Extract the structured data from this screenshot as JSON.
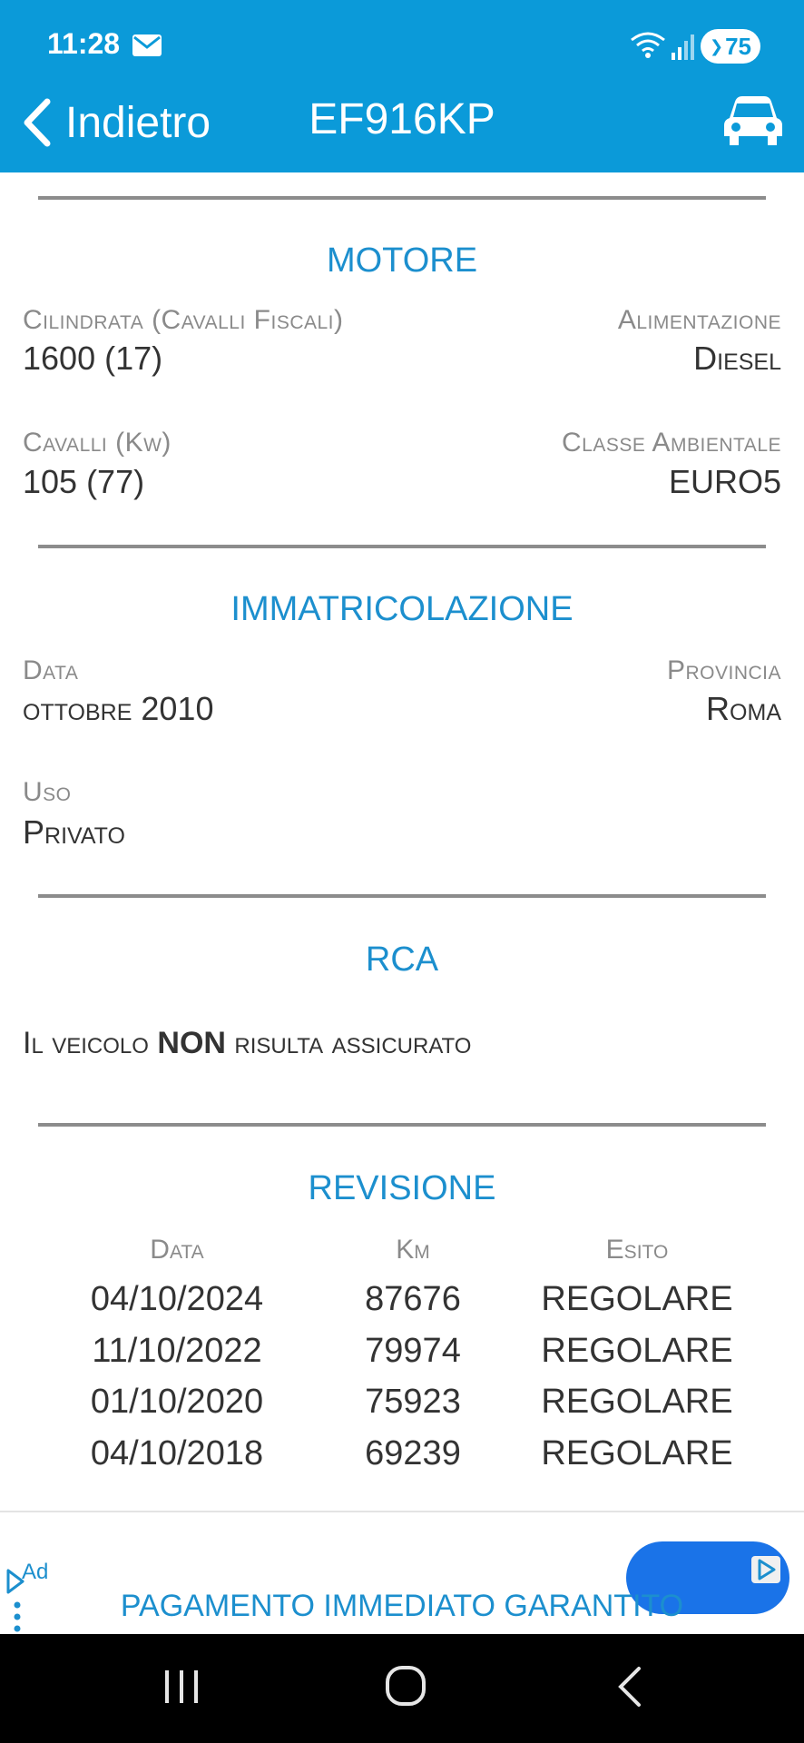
{
  "status_bar": {
    "time": "11:28",
    "battery": "75",
    "icons": [
      "mail-icon",
      "wifi-icon",
      "signal-icon",
      "battery-icon"
    ]
  },
  "header": {
    "back_label": "Indietro",
    "title": "EF916KP",
    "icons": [
      "chevron-left-icon",
      "car-icon"
    ],
    "background_color": "#0b9ad9"
  },
  "motore": {
    "title": "MOTORE",
    "cilindrata_label": "Cilindrata (Cavalli Fiscali)",
    "cilindrata_value": "1600 (17)",
    "alimentazione_label": "Alimentazione",
    "alimentazione_value": "Diesel",
    "cavalli_label": "Cavalli (Kw)",
    "cavalli_value": "105 (77)",
    "classe_label": "Classe Ambientale",
    "classe_value": "EURO5"
  },
  "immatricolazione": {
    "title": "IMMATRICOLAZIONE",
    "data_label": "Data",
    "data_value": "ottobre 2010",
    "provincia_label": "Provincia",
    "provincia_value": "Roma",
    "uso_label": "Uso",
    "uso_value": "Privato"
  },
  "rca": {
    "title": "RCA",
    "text_before": "Il veicolo ",
    "text_bold": "NON",
    "text_after": " risulta assicurato"
  },
  "revisione": {
    "title": "REVISIONE",
    "columns": [
      "Data",
      "Km",
      "Esito"
    ],
    "rows": [
      [
        "04/10/2024",
        "87676",
        "REGOLARE"
      ],
      [
        "11/10/2022",
        "79974",
        "REGOLARE"
      ],
      [
        "01/10/2020",
        "75923",
        "REGOLARE"
      ],
      [
        "04/10/2018",
        "69239",
        "REGOLARE"
      ]
    ]
  },
  "ad": {
    "label": "Ad",
    "headline": "PAGAMENTO IMMEDIATO GARANTITO",
    "icons": [
      "adchoices-icon",
      "more-vert-icon",
      "ad-play-icon"
    ]
  },
  "navbar": {
    "icons": [
      "recents-icon",
      "home-icon",
      "back-icon"
    ]
  },
  "colors": {
    "accent": "#1c8fce",
    "divider": "#8c8c8c",
    "label": "#8a8a8a"
  }
}
